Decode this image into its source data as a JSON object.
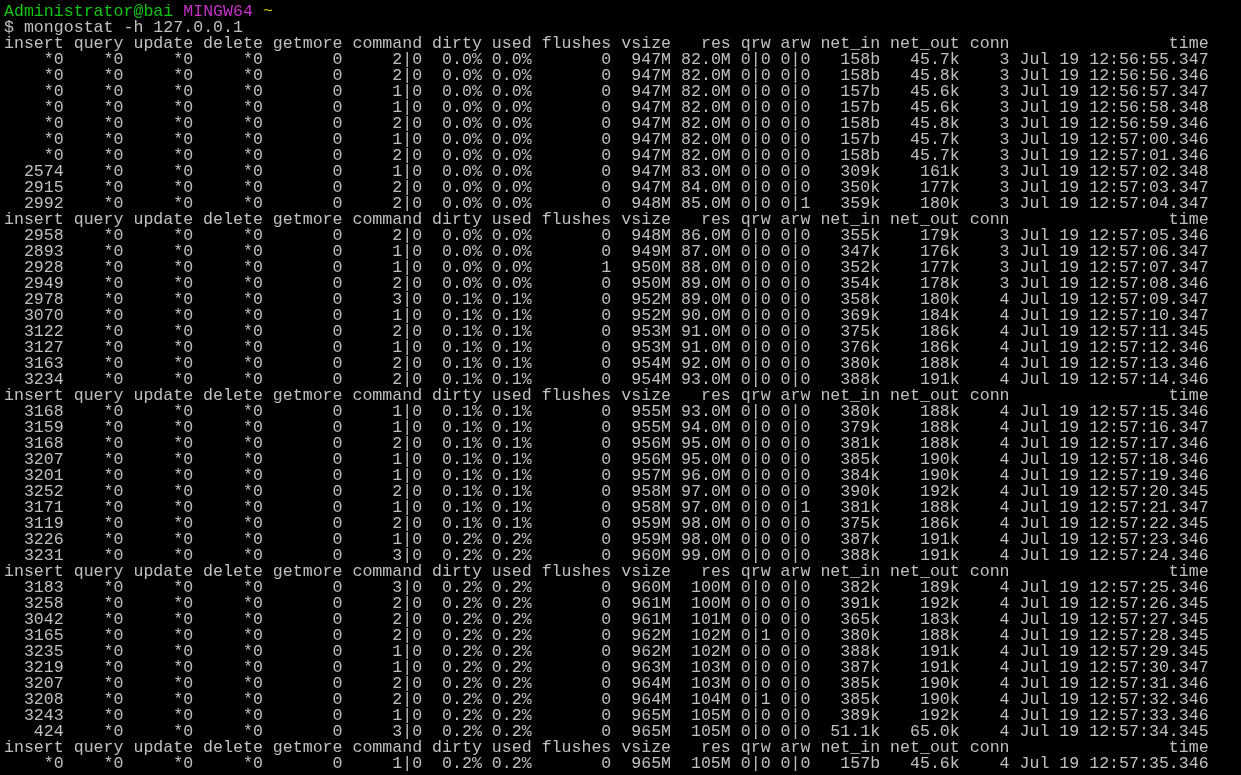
{
  "prompt": {
    "user_host": "Administrator@bai",
    "system": "MINGW64",
    "path": "~"
  },
  "command_line": "$ mongostat -h 127.0.0.1",
  "blocks": [
    {
      "header": [
        "insert",
        "query",
        "update",
        "delete",
        "getmore",
        "command",
        "dirty",
        "used",
        "flushes",
        "vsize",
        "res",
        "qrw",
        "arw",
        "net_in",
        "net_out",
        "conn",
        "time"
      ],
      "rows": [
        [
          "*0",
          "*0",
          "*0",
          "*0",
          "0",
          "2|0",
          "0.0%",
          "0.0%",
          "0",
          "947M",
          "82.0M",
          "0|0",
          "0|0",
          "158b",
          "45.7k",
          "3",
          "Jul 19 12:56:55.347"
        ],
        [
          "*0",
          "*0",
          "*0",
          "*0",
          "0",
          "2|0",
          "0.0%",
          "0.0%",
          "0",
          "947M",
          "82.0M",
          "0|0",
          "0|0",
          "158b",
          "45.8k",
          "3",
          "Jul 19 12:56:56.346"
        ],
        [
          "*0",
          "*0",
          "*0",
          "*0",
          "0",
          "1|0",
          "0.0%",
          "0.0%",
          "0",
          "947M",
          "82.0M",
          "0|0",
          "0|0",
          "157b",
          "45.6k",
          "3",
          "Jul 19 12:56:57.347"
        ],
        [
          "*0",
          "*0",
          "*0",
          "*0",
          "0",
          "1|0",
          "0.0%",
          "0.0%",
          "0",
          "947M",
          "82.0M",
          "0|0",
          "0|0",
          "157b",
          "45.6k",
          "3",
          "Jul 19 12:56:58.348"
        ],
        [
          "*0",
          "*0",
          "*0",
          "*0",
          "0",
          "2|0",
          "0.0%",
          "0.0%",
          "0",
          "947M",
          "82.0M",
          "0|0",
          "0|0",
          "158b",
          "45.8k",
          "3",
          "Jul 19 12:56:59.346"
        ],
        [
          "*0",
          "*0",
          "*0",
          "*0",
          "0",
          "1|0",
          "0.0%",
          "0.0%",
          "0",
          "947M",
          "82.0M",
          "0|0",
          "0|0",
          "157b",
          "45.7k",
          "3",
          "Jul 19 12:57:00.346"
        ],
        [
          "*0",
          "*0",
          "*0",
          "*0",
          "0",
          "2|0",
          "0.0%",
          "0.0%",
          "0",
          "947M",
          "82.0M",
          "0|0",
          "0|0",
          "158b",
          "45.7k",
          "3",
          "Jul 19 12:57:01.346"
        ],
        [
          "2574",
          "*0",
          "*0",
          "*0",
          "0",
          "1|0",
          "0.0%",
          "0.0%",
          "0",
          "947M",
          "83.0M",
          "0|0",
          "0|0",
          "309k",
          "161k",
          "3",
          "Jul 19 12:57:02.348"
        ],
        [
          "2915",
          "*0",
          "*0",
          "*0",
          "0",
          "2|0",
          "0.0%",
          "0.0%",
          "0",
          "947M",
          "84.0M",
          "0|0",
          "0|0",
          "350k",
          "177k",
          "3",
          "Jul 19 12:57:03.347"
        ],
        [
          "2992",
          "*0",
          "*0",
          "*0",
          "0",
          "2|0",
          "0.0%",
          "0.0%",
          "0",
          "948M",
          "85.0M",
          "0|0",
          "0|1",
          "359k",
          "180k",
          "3",
          "Jul 19 12:57:04.347"
        ]
      ]
    },
    {
      "header": [
        "insert",
        "query",
        "update",
        "delete",
        "getmore",
        "command",
        "dirty",
        "used",
        "flushes",
        "vsize",
        "res",
        "qrw",
        "arw",
        "net_in",
        "net_out",
        "conn",
        "time"
      ],
      "rows": [
        [
          "2958",
          "*0",
          "*0",
          "*0",
          "0",
          "2|0",
          "0.0%",
          "0.0%",
          "0",
          "948M",
          "86.0M",
          "0|0",
          "0|0",
          "355k",
          "179k",
          "3",
          "Jul 19 12:57:05.346"
        ],
        [
          "2893",
          "*0",
          "*0",
          "*0",
          "0",
          "1|0",
          "0.0%",
          "0.0%",
          "0",
          "949M",
          "87.0M",
          "0|0",
          "0|0",
          "347k",
          "176k",
          "3",
          "Jul 19 12:57:06.347"
        ],
        [
          "2928",
          "*0",
          "*0",
          "*0",
          "0",
          "1|0",
          "0.0%",
          "0.0%",
          "1",
          "950M",
          "88.0M",
          "0|0",
          "0|0",
          "352k",
          "177k",
          "3",
          "Jul 19 12:57:07.347"
        ],
        [
          "2949",
          "*0",
          "*0",
          "*0",
          "0",
          "2|0",
          "0.0%",
          "0.0%",
          "0",
          "950M",
          "89.0M",
          "0|0",
          "0|0",
          "354k",
          "178k",
          "3",
          "Jul 19 12:57:08.346"
        ],
        [
          "2978",
          "*0",
          "*0",
          "*0",
          "0",
          "3|0",
          "0.1%",
          "0.1%",
          "0",
          "952M",
          "89.0M",
          "0|0",
          "0|0",
          "358k",
          "180k",
          "4",
          "Jul 19 12:57:09.347"
        ],
        [
          "3070",
          "*0",
          "*0",
          "*0",
          "0",
          "1|0",
          "0.1%",
          "0.1%",
          "0",
          "952M",
          "90.0M",
          "0|0",
          "0|0",
          "369k",
          "184k",
          "4",
          "Jul 19 12:57:10.347"
        ],
        [
          "3122",
          "*0",
          "*0",
          "*0",
          "0",
          "2|0",
          "0.1%",
          "0.1%",
          "0",
          "953M",
          "91.0M",
          "0|0",
          "0|0",
          "375k",
          "186k",
          "4",
          "Jul 19 12:57:11.345"
        ],
        [
          "3127",
          "*0",
          "*0",
          "*0",
          "0",
          "1|0",
          "0.1%",
          "0.1%",
          "0",
          "953M",
          "91.0M",
          "0|0",
          "0|0",
          "376k",
          "186k",
          "4",
          "Jul 19 12:57:12.346"
        ],
        [
          "3163",
          "*0",
          "*0",
          "*0",
          "0",
          "2|0",
          "0.1%",
          "0.1%",
          "0",
          "954M",
          "92.0M",
          "0|0",
          "0|0",
          "380k",
          "188k",
          "4",
          "Jul 19 12:57:13.346"
        ],
        [
          "3234",
          "*0",
          "*0",
          "*0",
          "0",
          "2|0",
          "0.1%",
          "0.1%",
          "0",
          "954M",
          "93.0M",
          "0|0",
          "0|0",
          "388k",
          "191k",
          "4",
          "Jul 19 12:57:14.346"
        ]
      ]
    },
    {
      "header": [
        "insert",
        "query",
        "update",
        "delete",
        "getmore",
        "command",
        "dirty",
        "used",
        "flushes",
        "vsize",
        "res",
        "qrw",
        "arw",
        "net_in",
        "net_out",
        "conn",
        "time"
      ],
      "rows": [
        [
          "3168",
          "*0",
          "*0",
          "*0",
          "0",
          "1|0",
          "0.1%",
          "0.1%",
          "0",
          "955M",
          "93.0M",
          "0|0",
          "0|0",
          "380k",
          "188k",
          "4",
          "Jul 19 12:57:15.346"
        ],
        [
          "3159",
          "*0",
          "*0",
          "*0",
          "0",
          "1|0",
          "0.1%",
          "0.1%",
          "0",
          "955M",
          "94.0M",
          "0|0",
          "0|0",
          "379k",
          "188k",
          "4",
          "Jul 19 12:57:16.347"
        ],
        [
          "3168",
          "*0",
          "*0",
          "*0",
          "0",
          "2|0",
          "0.1%",
          "0.1%",
          "0",
          "956M",
          "95.0M",
          "0|0",
          "0|0",
          "381k",
          "188k",
          "4",
          "Jul 19 12:57:17.346"
        ],
        [
          "3207",
          "*0",
          "*0",
          "*0",
          "0",
          "1|0",
          "0.1%",
          "0.1%",
          "0",
          "956M",
          "95.0M",
          "0|0",
          "0|0",
          "385k",
          "190k",
          "4",
          "Jul 19 12:57:18.346"
        ],
        [
          "3201",
          "*0",
          "*0",
          "*0",
          "0",
          "1|0",
          "0.1%",
          "0.1%",
          "0",
          "957M",
          "96.0M",
          "0|0",
          "0|0",
          "384k",
          "190k",
          "4",
          "Jul 19 12:57:19.346"
        ],
        [
          "3252",
          "*0",
          "*0",
          "*0",
          "0",
          "2|0",
          "0.1%",
          "0.1%",
          "0",
          "958M",
          "97.0M",
          "0|0",
          "0|0",
          "390k",
          "192k",
          "4",
          "Jul 19 12:57:20.345"
        ],
        [
          "3171",
          "*0",
          "*0",
          "*0",
          "0",
          "1|0",
          "0.1%",
          "0.1%",
          "0",
          "958M",
          "97.0M",
          "0|0",
          "0|1",
          "381k",
          "188k",
          "4",
          "Jul 19 12:57:21.347"
        ],
        [
          "3119",
          "*0",
          "*0",
          "*0",
          "0",
          "2|0",
          "0.1%",
          "0.1%",
          "0",
          "959M",
          "98.0M",
          "0|0",
          "0|0",
          "375k",
          "186k",
          "4",
          "Jul 19 12:57:22.345"
        ],
        [
          "3226",
          "*0",
          "*0",
          "*0",
          "0",
          "1|0",
          "0.2%",
          "0.2%",
          "0",
          "959M",
          "98.0M",
          "0|0",
          "0|0",
          "387k",
          "191k",
          "4",
          "Jul 19 12:57:23.346"
        ],
        [
          "3231",
          "*0",
          "*0",
          "*0",
          "0",
          "3|0",
          "0.2%",
          "0.2%",
          "0",
          "960M",
          "99.0M",
          "0|0",
          "0|0",
          "388k",
          "191k",
          "4",
          "Jul 19 12:57:24.346"
        ]
      ]
    },
    {
      "header": [
        "insert",
        "query",
        "update",
        "delete",
        "getmore",
        "command",
        "dirty",
        "used",
        "flushes",
        "vsize",
        "res",
        "qrw",
        "arw",
        "net_in",
        "net_out",
        "conn",
        "time"
      ],
      "rows": [
        [
          "3183",
          "*0",
          "*0",
          "*0",
          "0",
          "3|0",
          "0.2%",
          "0.2%",
          "0",
          "960M",
          "100M",
          "0|0",
          "0|0",
          "382k",
          "189k",
          "4",
          "Jul 19 12:57:25.346"
        ],
        [
          "3258",
          "*0",
          "*0",
          "*0",
          "0",
          "2|0",
          "0.2%",
          "0.2%",
          "0",
          "961M",
          "100M",
          "0|0",
          "0|0",
          "391k",
          "192k",
          "4",
          "Jul 19 12:57:26.345"
        ],
        [
          "3042",
          "*0",
          "*0",
          "*0",
          "0",
          "2|0",
          "0.2%",
          "0.2%",
          "0",
          "961M",
          "101M",
          "0|0",
          "0|0",
          "365k",
          "183k",
          "4",
          "Jul 19 12:57:27.345"
        ],
        [
          "3165",
          "*0",
          "*0",
          "*0",
          "0",
          "2|0",
          "0.2%",
          "0.2%",
          "0",
          "962M",
          "102M",
          "0|1",
          "0|0",
          "380k",
          "188k",
          "4",
          "Jul 19 12:57:28.345"
        ],
        [
          "3235",
          "*0",
          "*0",
          "*0",
          "0",
          "1|0",
          "0.2%",
          "0.2%",
          "0",
          "962M",
          "102M",
          "0|0",
          "0|0",
          "388k",
          "191k",
          "4",
          "Jul 19 12:57:29.345"
        ],
        [
          "3219",
          "*0",
          "*0",
          "*0",
          "0",
          "1|0",
          "0.2%",
          "0.2%",
          "0",
          "963M",
          "103M",
          "0|0",
          "0|0",
          "387k",
          "191k",
          "4",
          "Jul 19 12:57:30.347"
        ],
        [
          "3207",
          "*0",
          "*0",
          "*0",
          "0",
          "2|0",
          "0.2%",
          "0.2%",
          "0",
          "964M",
          "103M",
          "0|0",
          "0|0",
          "385k",
          "190k",
          "4",
          "Jul 19 12:57:31.346"
        ],
        [
          "3208",
          "*0",
          "*0",
          "*0",
          "0",
          "2|0",
          "0.2%",
          "0.2%",
          "0",
          "964M",
          "104M",
          "0|1",
          "0|0",
          "385k",
          "190k",
          "4",
          "Jul 19 12:57:32.346"
        ],
        [
          "3243",
          "*0",
          "*0",
          "*0",
          "0",
          "1|0",
          "0.2%",
          "0.2%",
          "0",
          "965M",
          "105M",
          "0|0",
          "0|0",
          "389k",
          "192k",
          "4",
          "Jul 19 12:57:33.346"
        ],
        [
          "424",
          "*0",
          "*0",
          "*0",
          "0",
          "3|0",
          "0.2%",
          "0.2%",
          "0",
          "965M",
          "105M",
          "0|0",
          "0|0",
          "51.1k",
          "65.0k",
          "4",
          "Jul 19 12:57:34.345"
        ]
      ]
    },
    {
      "header": [
        "insert",
        "query",
        "update",
        "delete",
        "getmore",
        "command",
        "dirty",
        "used",
        "flushes",
        "vsize",
        "res",
        "qrw",
        "arw",
        "net_in",
        "net_out",
        "conn",
        "time"
      ],
      "rows": [
        [
          "*0",
          "*0",
          "*0",
          "*0",
          "0",
          "1|0",
          "0.2%",
          "0.2%",
          "0",
          "965M",
          "105M",
          "0|0",
          "0|0",
          "157b",
          "45.6k",
          "4",
          "Jul 19 12:57:35.346"
        ]
      ]
    }
  ]
}
